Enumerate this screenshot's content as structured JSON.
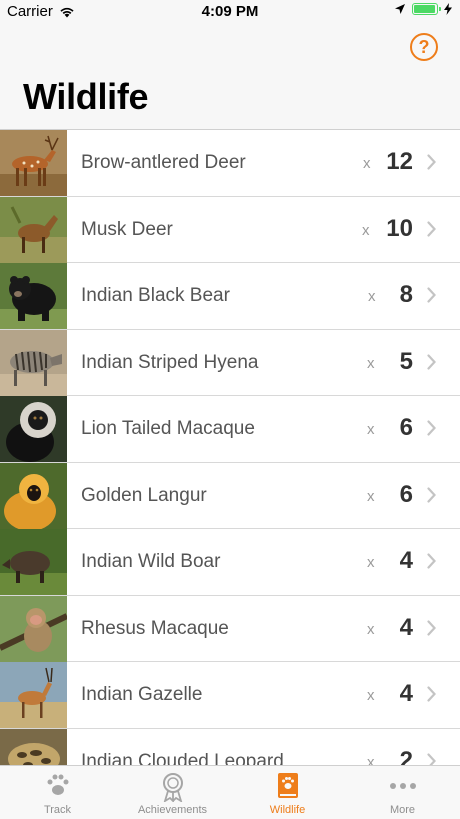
{
  "status_bar": {
    "carrier": "Carrier",
    "time": "4:09 PM"
  },
  "title": "Wildlife",
  "help_glyph": "?",
  "count_prefix": "x",
  "animals": [
    {
      "name": "Brow-antlered Deer",
      "count": "12"
    },
    {
      "name": "Musk Deer",
      "count": "10"
    },
    {
      "name": "Indian Black Bear",
      "count": "8"
    },
    {
      "name": "Indian Striped Hyena",
      "count": "5"
    },
    {
      "name": "Lion Tailed Macaque",
      "count": "6"
    },
    {
      "name": "Golden Langur",
      "count": "6"
    },
    {
      "name": "Indian Wild Boar",
      "count": "4"
    },
    {
      "name": "Rhesus Macaque",
      "count": "4"
    },
    {
      "name": "Indian Gazelle",
      "count": "4"
    },
    {
      "name": "Indian Clouded Leopard",
      "count": "2"
    }
  ],
  "tabs": [
    {
      "label": "Track",
      "icon": "paw-print-icon"
    },
    {
      "label": "Achievements",
      "icon": "medal-icon"
    },
    {
      "label": "Wildlife",
      "icon": "wildlife-book-icon",
      "active": true
    },
    {
      "label": "More",
      "icon": "more-dots-icon"
    }
  ],
  "colors": {
    "accent": "#ee7d1a",
    "battery": "#4cd964"
  }
}
